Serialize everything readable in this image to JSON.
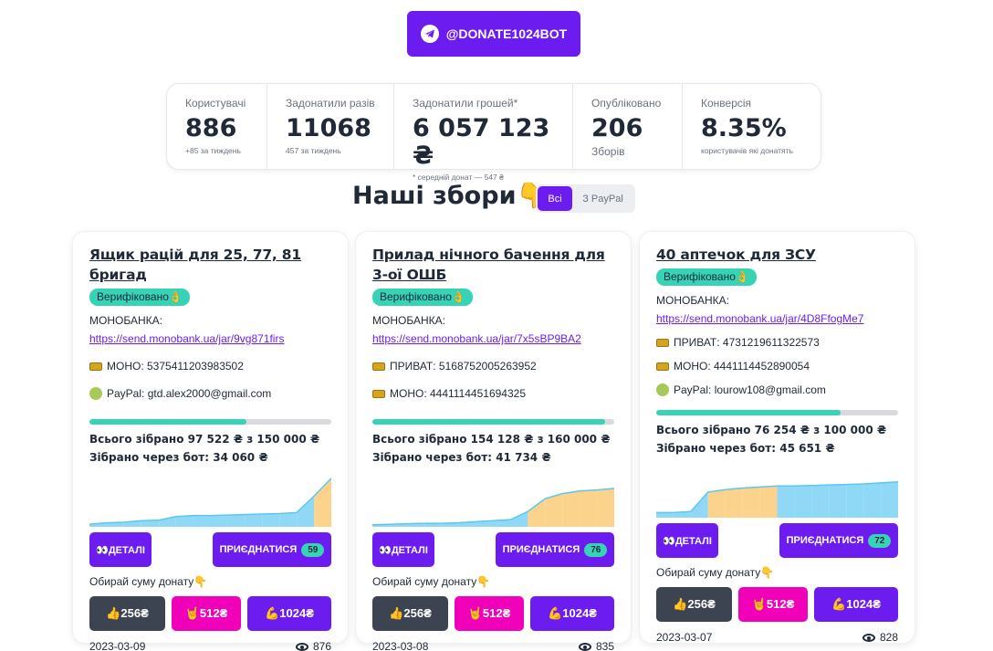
{
  "telegram_button": {
    "label": "@DONATE1024BOT",
    "icon": "telegram-icon"
  },
  "stats": [
    {
      "title": "Користувачі",
      "value": "886",
      "desc": "+85 за тиждень"
    },
    {
      "title": "Задонатили разів",
      "value": "11068",
      "desc": "457 за тиждень"
    },
    {
      "title": "Задонатили грошей*",
      "value": "6 057 123 ₴",
      "desc": "* середній донат — 547 ₴"
    },
    {
      "title": "Опубліковано",
      "value": "206",
      "desc": "Зборів"
    },
    {
      "title": "Конверсія",
      "value": "8.35%",
      "desc": "користувачів які донатять"
    }
  ],
  "heading": "Наші збори👇",
  "tabs": {
    "all": "Всі",
    "paypal": "З PayPal"
  },
  "colors": {
    "primary": "#6d1cf0",
    "accent": "#36d3b7",
    "secondary": "#f000b8",
    "neutral": "#3d4451",
    "chart_blue": "#8fd9f7",
    "chart_yellow": "#fbd38d"
  },
  "common": {
    "verified": "Верифіковано👌",
    "mono_label": "МОНОБАНКА:",
    "details": "👀ДЕТАЛІ",
    "join": "ПРИЄДНАТИСЯ",
    "choose": "Обирай суму донату👇",
    "amount_256": "👍256₴",
    "amount_512": "🤘512₴",
    "amount_1024": "💪1024₴"
  },
  "cards": [
    {
      "title": "Ящик рацій для 25, 77, 81 бригад",
      "jar_link": "https://send.monobank.ua/jar/9vg871firs",
      "payments": [
        {
          "icon": "card-icon",
          "text": "МОНО: 5375411203983502"
        },
        {
          "icon": "paypal-icon",
          "text": "PayPal: gtd.alex2000@gmail.com"
        }
      ],
      "progress": 0.65,
      "total": "Всього зібрано 97 522 ₴ з 150 000 ₴",
      "via_bot": "Зібрано через бот: 34 060 ₴",
      "participants": "59",
      "date": "2023-03-09",
      "views": "876"
    },
    {
      "title": "Прилад нічного бачення для 3-ої ОШБ",
      "jar_link": "https://send.monobank.ua/jar/7x5sBP9BA2",
      "payments": [
        {
          "icon": "card-icon",
          "text": "ПРИВАТ: 5168752005263952"
        },
        {
          "icon": "card-icon",
          "text": "МОНО: 4441114451694325"
        }
      ],
      "progress": 0.963,
      "total": "Всього зібрано 154 128 ₴ з 160 000 ₴",
      "via_bot": "Зібрано через бот: 41 734 ₴",
      "participants": "76",
      "date": "2023-03-08",
      "views": "835"
    },
    {
      "title": "40 аптечок для ЗСУ",
      "jar_link": "https://send.monobank.ua/jar/4D8FfogMe7",
      "payments": [
        {
          "icon": "card-icon",
          "text": "ПРИВАТ: 4731219611322573"
        },
        {
          "icon": "card-icon",
          "text": "МОНО: 4441114452890054"
        },
        {
          "icon": "paypal-icon",
          "text": "PayPal: lourow108@gmail.com"
        }
      ],
      "progress": 0.762,
      "total": "Всього зібрано 76 254 ₴ з 100 000 ₴",
      "via_bot": "Зібрано через бот: 45 651 ₴",
      "participants": "72",
      "date": "2023-03-07",
      "views": "828"
    }
  ],
  "chart_data": [
    {
      "type": "area",
      "series": [
        {
          "values": [
            5,
            8,
            9,
            12,
            13,
            20,
            22,
            22,
            23,
            24,
            25,
            26,
            28,
            60,
            95
          ]
        }
      ],
      "highlight_from": 13
    },
    {
      "type": "area",
      "series": [
        {
          "values": [
            4,
            5,
            6,
            7,
            7,
            8,
            10,
            12,
            14,
            30,
            55,
            65,
            70,
            72,
            75
          ]
        }
      ],
      "highlight_from": 9
    },
    {
      "type": "area",
      "series": [
        {
          "values": [
            10,
            10,
            12,
            50,
            55,
            58,
            60,
            62,
            62,
            63,
            64,
            65,
            66,
            68,
            70
          ]
        }
      ],
      "highlight_from": 3,
      "highlight_to": 7
    }
  ]
}
